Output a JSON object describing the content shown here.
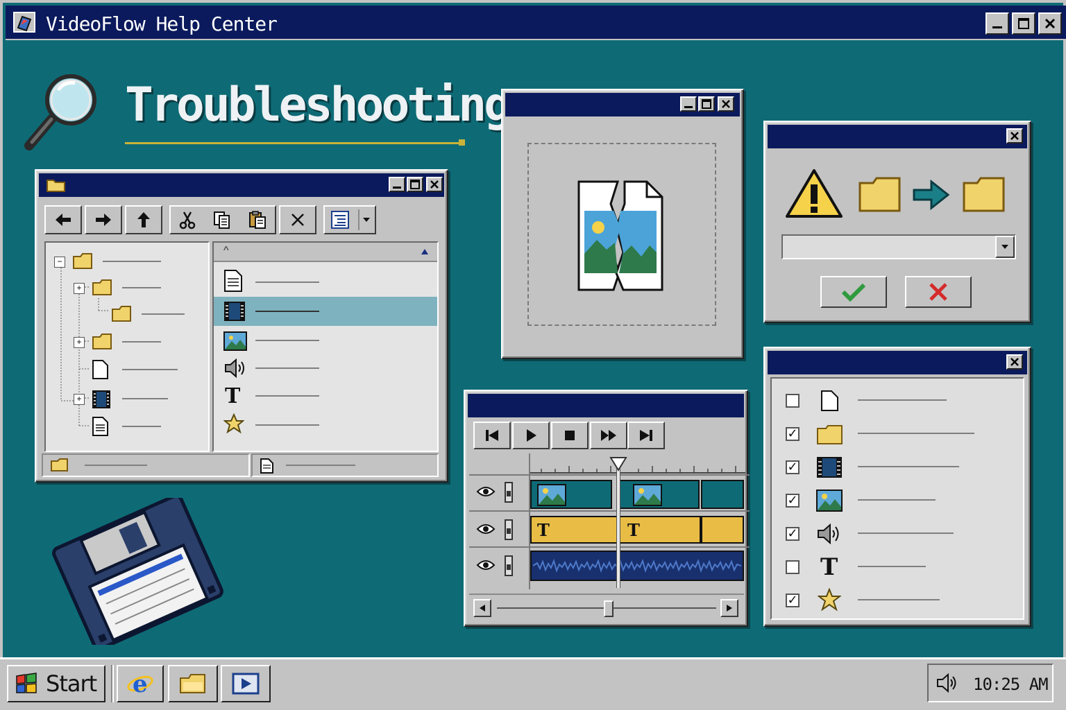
{
  "window": {
    "title": "VideoFlow Help Center",
    "controls": [
      "_",
      "□",
      "×"
    ]
  },
  "page": {
    "heading": "Troubleshooting",
    "accent": "#c9b23a"
  },
  "explorer": {
    "tree_items": [
      "folder",
      "folder",
      "folder",
      "folder",
      "file",
      "film",
      "document"
    ],
    "list_header": "^",
    "list_items": [
      {
        "icon": "document-icon"
      },
      {
        "icon": "film-icon",
        "selected": true
      },
      {
        "icon": "image-icon"
      },
      {
        "icon": "speaker-icon"
      },
      {
        "icon": "text-icon",
        "glyph": "T"
      },
      {
        "icon": "star-icon"
      }
    ]
  },
  "editor": {
    "title_glyph_text": "T",
    "clip_text_label": "T"
  },
  "checklist": {
    "items": [
      {
        "checked": false,
        "icon": "document-icon"
      },
      {
        "checked": true,
        "icon": "folder-icon"
      },
      {
        "checked": true,
        "icon": "film-icon"
      },
      {
        "checked": true,
        "icon": "image-icon"
      },
      {
        "checked": true,
        "icon": "speaker-icon"
      },
      {
        "checked": false,
        "icon": "text-icon",
        "glyph": "T"
      },
      {
        "checked": true,
        "icon": "star-icon"
      }
    ],
    "check_glyph": "✓"
  },
  "taskbar": {
    "start_label": "Start",
    "clock": "10:25 AM"
  },
  "colors": {
    "desktop": "#0e6b76",
    "titlebar": "#0b1a5c",
    "selection": "#7fb2bf",
    "clip_video": "#0e6b76",
    "clip_text": "#e9bd45",
    "clip_audio": "#18306e"
  }
}
